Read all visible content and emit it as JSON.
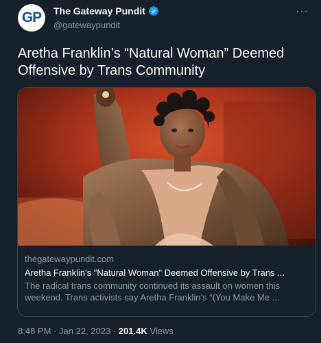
{
  "account": {
    "display_name": "The Gateway Pundit",
    "handle": "@gatewaypundit",
    "avatar_text": "GP",
    "verified_icon": "verified-badge-icon",
    "more_icon": "more-options-icon"
  },
  "tweet": {
    "text": "Aretha Franklin’s “Natural Woman” Deemed Offensive by Trans Community"
  },
  "card": {
    "domain": "thegatewaypundit.com",
    "title": "Aretha Franklin's \"Natural Woman\" Deemed Offensive by Trans ...",
    "description": "The radical trans community continued its assault on women this weekend. Trans activists say Aretha Franklin’s “(You Make Me ...",
    "image_alt": "Aretha Franklin in a fur coat raising her arm on stage"
  },
  "meta": {
    "time": "8:48 PM",
    "separator": "·",
    "date": "Jan 22, 2023",
    "views_count": "201.4K",
    "views_label": "Views"
  },
  "colors": {
    "background": "#15202b",
    "text_primary": "#f7f9f9",
    "text_secondary": "#8b98a5",
    "border": "#38444d",
    "verified": "#1d9bf0",
    "avatar_blue": "#1b4f9c"
  }
}
